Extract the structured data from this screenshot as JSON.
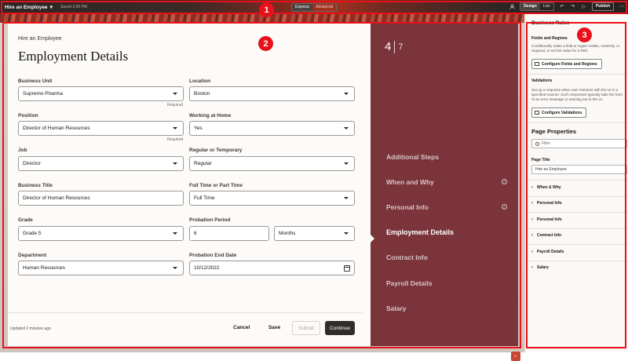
{
  "topbar": {
    "app_title": "Hire an Employee",
    "saved": "Saved 3:59 PM",
    "mode_toggle": [
      "Express",
      "Advanced"
    ],
    "view_toggle": [
      "Design",
      "Live"
    ],
    "publish": "Publish"
  },
  "form": {
    "eyebrow": "Hire an Employee",
    "title": "Employment Details",
    "required_text": "Required",
    "fields": {
      "business_unit": {
        "label": "Business Unit",
        "value": "Supremo Pharma"
      },
      "location": {
        "label": "Location",
        "value": "Boston"
      },
      "position": {
        "label": "Position",
        "value": "Director of Human Resources"
      },
      "working_at_home": {
        "label": "Working at Home",
        "value": "Yes"
      },
      "job": {
        "label": "Job",
        "value": "Director"
      },
      "regular_temporary": {
        "label": "Regular or Temporary",
        "value": "Regular"
      },
      "business_title": {
        "label": "Business Title",
        "value": "Director of Human Resources"
      },
      "full_part_time": {
        "label": "Full Time or Part Time",
        "value": "Full Time"
      },
      "grade": {
        "label": "Grade",
        "value": "Grade 5"
      },
      "probation_period": {
        "label": "Probation Period",
        "value": "6",
        "unit": "Months"
      },
      "department": {
        "label": "Department",
        "value": "Human Resources"
      },
      "probation_end_date": {
        "label": "Probation End Date",
        "value": "10/12/2022"
      }
    },
    "footer": {
      "updated": "Updated 2 minutes ago",
      "cancel": "Cancel",
      "save": "Save",
      "submit": "Submit",
      "continue": "Continue"
    }
  },
  "steps": {
    "current": "4",
    "total": "7",
    "items": [
      {
        "label": "Additional Steps",
        "state": "pending"
      },
      {
        "label": "When and Why",
        "state": "done"
      },
      {
        "label": "Personal Info",
        "state": "done"
      },
      {
        "label": "Employment Details",
        "state": "current"
      },
      {
        "label": "Contract Info",
        "state": "pending"
      },
      {
        "label": "Payroll Details",
        "state": "pending"
      },
      {
        "label": "Salary",
        "state": "pending"
      }
    ]
  },
  "right_panel": {
    "title": "Business Rules",
    "fields_regions": {
      "heading": "Fields and Regions",
      "desc": "Conditionally make a field or region visible, readonly, or required, or set the value for a field.",
      "button": "Configure Fields and Regions"
    },
    "validations": {
      "heading": "Validations",
      "desc": "Set up a response when user interacts with the UI in a specified manner. Such responses typically take the form of an error message or warning set to the UI.",
      "button": "Configure Validations"
    },
    "page_properties": {
      "heading": "Page Properties",
      "filter_placeholder": "Filter",
      "page_title_label": "Page Title",
      "page_title_value": "Hire an Employee",
      "sections": [
        "When & Why",
        "Personal Info",
        "Personal Info",
        "Contract Info",
        "Payroll Details",
        "Salary"
      ]
    }
  },
  "annotations": [
    "1",
    "2",
    "3"
  ],
  "colors": {
    "highlight": "#e8101a",
    "steps_bg": "#7a343a",
    "primary_button": "#312d2a"
  }
}
